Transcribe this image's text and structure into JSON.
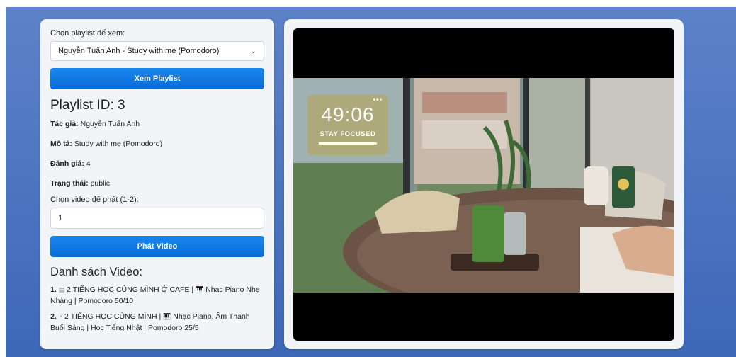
{
  "left_panel": {
    "select_label": "Chọn playlist để xem:",
    "selected_playlist": "Nguyễn Tuấn Anh - Study with me (Pomodoro)",
    "view_button": "Xem Playlist",
    "playlist_id": "Playlist ID: 3",
    "author_label": "Tác giả:",
    "author_value": "Nguyễn Tuấn Anh",
    "desc_label": "Mô tả:",
    "desc_value": "Study with me (Pomodoro)",
    "rating_label": "Đánh giá:",
    "rating_value": "4",
    "status_label": "Trạng thái:",
    "status_value": "public",
    "video_select_label": "Chọn video để phát (1-2):",
    "video_input_value": "1",
    "play_button": "Phát Video",
    "video_list_heading": "Danh sách Video:",
    "videos": [
      {
        "num": "1.",
        "text_a": "2 TIẾNG HỌC CÙNG MÌNH Ở CAFE |",
        "text_b": "Nhạc Piano Nhẹ Nhàng | Pomodoro 50/10"
      },
      {
        "num": "2.",
        "text_a": "2 TIẾNG HỌC CÙNG MÌNH |",
        "text_b": "Nhạc Piano, Âm Thanh Buổi Sáng | Học Tiếng Nhật | Pomodoro 25/5"
      }
    ]
  },
  "video": {
    "timer_value": "49:06",
    "timer_caption": "STAY FOCUSED",
    "timer_menu": "•••"
  },
  "colors": {
    "background": "#4a74c0",
    "button": "#0f74e0",
    "timer_bg": "#b0aa78"
  }
}
